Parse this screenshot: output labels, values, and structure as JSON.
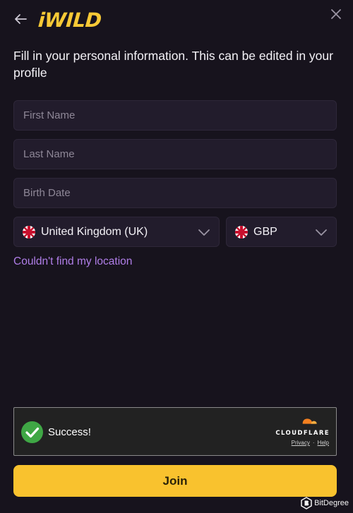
{
  "header": {
    "logo_text": "iWILD",
    "back_icon": "arrow-left-icon",
    "close_icon": "close-icon"
  },
  "intro_text": "Fill in your personal information. This can be edited in your profile",
  "form": {
    "first_name": {
      "placeholder": "First Name",
      "value": ""
    },
    "last_name": {
      "placeholder": "Last Name",
      "value": ""
    },
    "birth_date": {
      "placeholder": "Birth Date",
      "value": ""
    },
    "country": {
      "selected": "United Kingdom (UK)",
      "icon": "uk-flag-icon"
    },
    "currency": {
      "selected": "GBP",
      "icon": "uk-flag-icon"
    },
    "location_link": "Couldn't find my location"
  },
  "captcha": {
    "status": "Success!",
    "provider": "CLOUDFLARE",
    "privacy": "Privacy",
    "separator": "·",
    "help": "Help"
  },
  "join_label": "Join",
  "watermark": "BitDegree",
  "colors": {
    "background": "#17131d",
    "field": "#221c2c",
    "accent_yellow": "#f9c22e",
    "link_purple": "#b07ee8",
    "success_green": "#3fa745",
    "cloudflare_orange": "#f38020"
  }
}
